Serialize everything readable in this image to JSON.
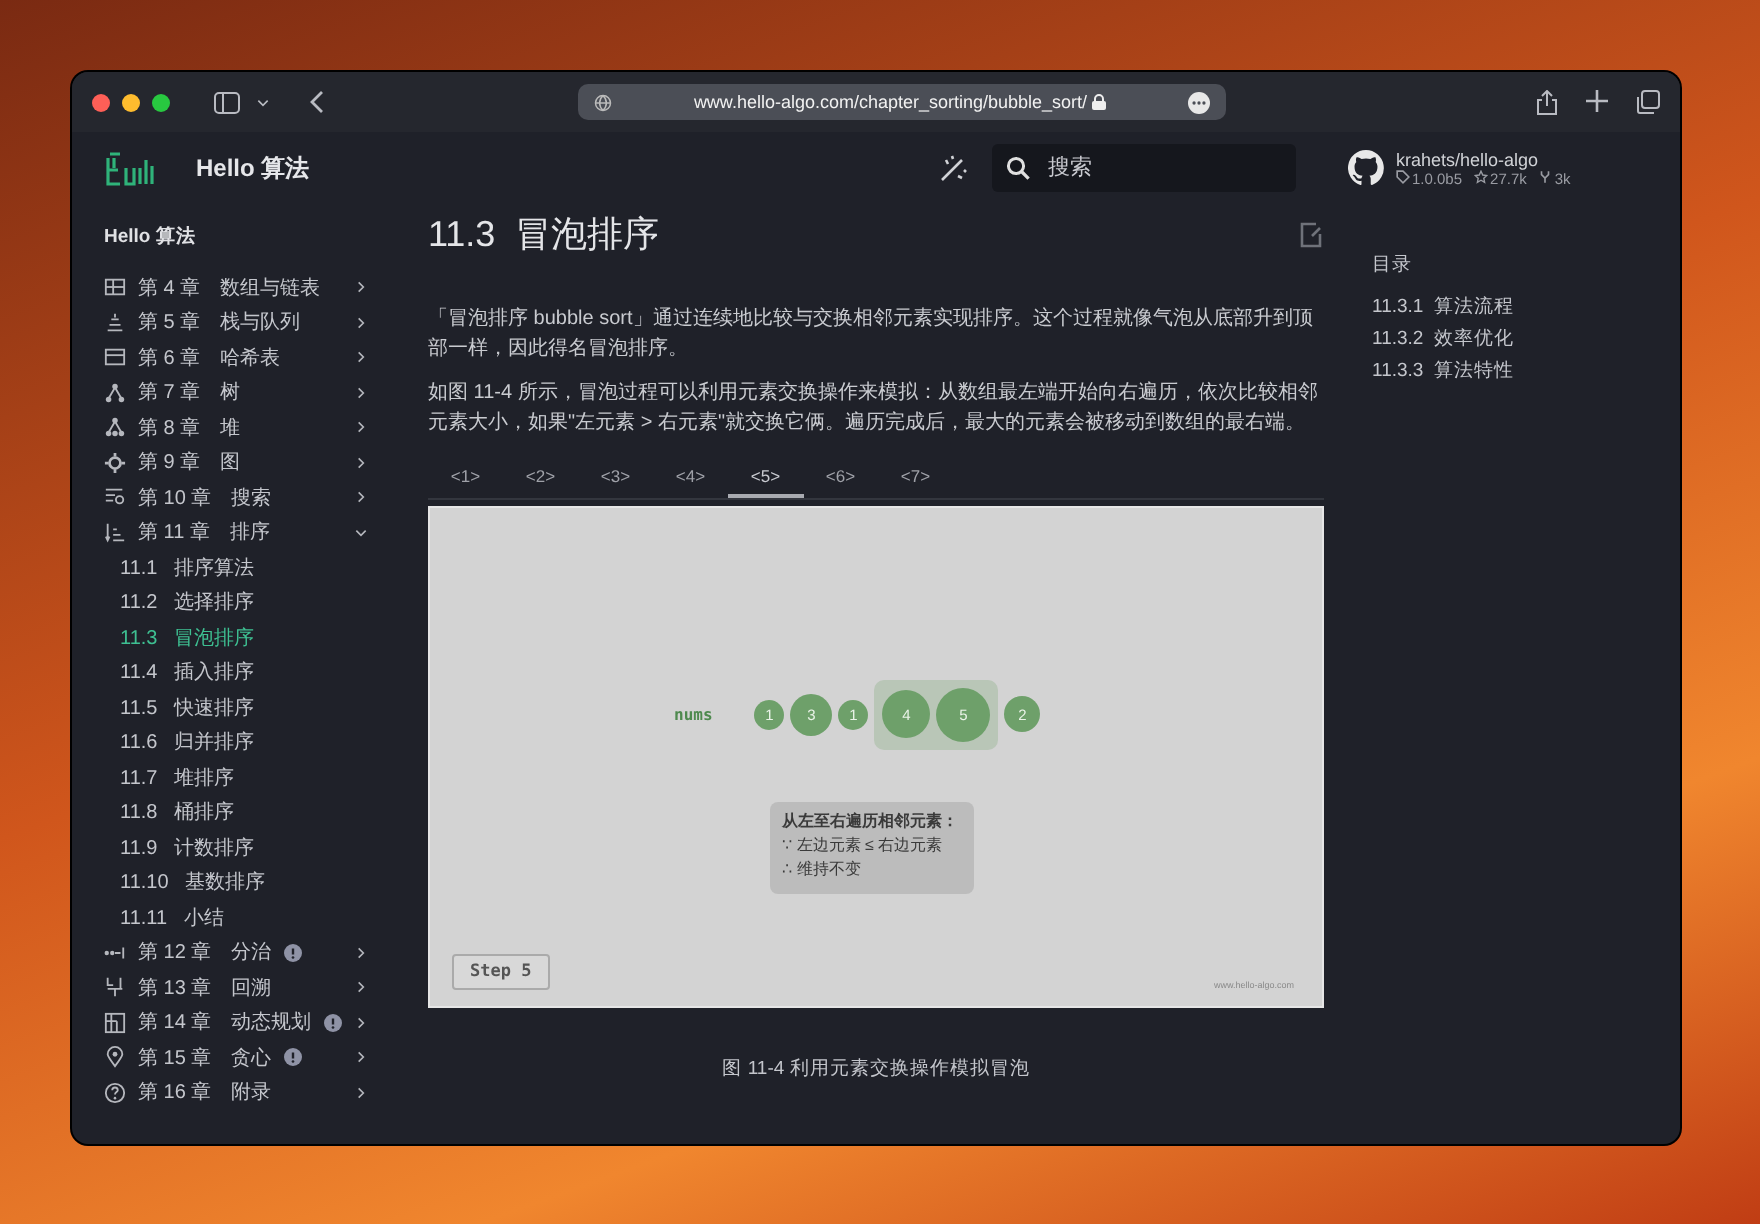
{
  "browser": {
    "url": "www.hello-algo.com/chapter_sorting/bubble_sort/"
  },
  "header": {
    "title": "Hello 算法",
    "search_placeholder": "搜索",
    "repo": {
      "name": "krahets/hello-algo",
      "version": "1.0.0b5",
      "stars": "27.7k",
      "forks": "3k"
    }
  },
  "sidebar": {
    "title": "Hello 算法",
    "items": [
      {
        "number": "第 4 章",
        "title": "数组与链表",
        "expanded": false,
        "badge": false
      },
      {
        "number": "第 5 章",
        "title": "栈与队列",
        "expanded": false,
        "badge": false
      },
      {
        "number": "第 6 章",
        "title": "哈希表",
        "expanded": false,
        "badge": false
      },
      {
        "number": "第 7 章",
        "title": "树",
        "expanded": false,
        "badge": false
      },
      {
        "number": "第 8 章",
        "title": "堆",
        "expanded": false,
        "badge": false
      },
      {
        "number": "第 9 章",
        "title": "图",
        "expanded": false,
        "badge": false
      },
      {
        "number": "第 10 章",
        "title": "搜索",
        "expanded": false,
        "badge": false
      },
      {
        "number": "第 11 章",
        "title": "排序",
        "expanded": true,
        "badge": false,
        "children": [
          {
            "number": "11.1",
            "title": "排序算法",
            "selected": false
          },
          {
            "number": "11.2",
            "title": "选择排序",
            "selected": false
          },
          {
            "number": "11.3",
            "title": "冒泡排序",
            "selected": true
          },
          {
            "number": "11.4",
            "title": "插入排序",
            "selected": false
          },
          {
            "number": "11.5",
            "title": "快速排序",
            "selected": false
          },
          {
            "number": "11.6",
            "title": "归并排序",
            "selected": false
          },
          {
            "number": "11.7",
            "title": "堆排序",
            "selected": false
          },
          {
            "number": "11.8",
            "title": "桶排序",
            "selected": false
          },
          {
            "number": "11.9",
            "title": "计数排序",
            "selected": false
          },
          {
            "number": "11.10",
            "title": "基数排序",
            "selected": false
          },
          {
            "number": "11.11",
            "title": "小结",
            "selected": false
          }
        ]
      },
      {
        "number": "第 12 章",
        "title": "分治",
        "expanded": false,
        "badge": true
      },
      {
        "number": "第 13 章",
        "title": "回溯",
        "expanded": false,
        "badge": false
      },
      {
        "number": "第 14 章",
        "title": "动态规划",
        "expanded": false,
        "badge": true
      },
      {
        "number": "第 15 章",
        "title": "贪心",
        "expanded": false,
        "badge": true
      },
      {
        "number": "第 16 章",
        "title": "附录",
        "expanded": false,
        "badge": false
      }
    ]
  },
  "content": {
    "heading_number": "11.3",
    "heading_title": "冒泡排序",
    "paragraphs": [
      "「冒泡排序 bubble sort」通过连续地比较与交换相邻元素实现排序。这个过程就像气泡从底部升到顶部一样，因此得名冒泡排序。",
      "如图 11-4 所示，冒泡过程可以利用元素交换操作来模拟：从数组最左端开始向右遍历，依次比较相邻元素大小，如果\"左元素 > 右元素\"就交换它俩。遍历完成后，最大的元素会被移动到数组的最右端。"
    ],
    "tabs": [
      {
        "label": "<1>",
        "selected": false
      },
      {
        "label": "<2>",
        "selected": false
      },
      {
        "label": "<3>",
        "selected": false
      },
      {
        "label": "<4>",
        "selected": false
      },
      {
        "label": "<5>",
        "selected": true
      },
      {
        "label": "<6>",
        "selected": false
      },
      {
        "label": "<7>",
        "selected": false
      }
    ],
    "figure": {
      "array_label": "nums",
      "elements": [
        {
          "value": "1",
          "highlighted": false
        },
        {
          "value": "3",
          "highlighted": false
        },
        {
          "value": "1",
          "highlighted": false
        },
        {
          "value": "4",
          "highlighted": true
        },
        {
          "value": "5",
          "highlighted": true
        },
        {
          "value": "2",
          "highlighted": false
        }
      ],
      "legend": {
        "title": "从左至右遍历相邻元素：",
        "lines": [
          "∵ 左边元素 ≤ 右边元素",
          "∴ 维持不变"
        ]
      },
      "step": "Step 5",
      "site": "www.hello-algo.com"
    },
    "caption": "图 11-4   利用元素交换操作模拟冒泡"
  },
  "toc": {
    "title": "目录",
    "items": [
      {
        "number": "11.3.1",
        "title": "算法流程"
      },
      {
        "number": "11.3.2",
        "title": "效率优化"
      },
      {
        "number": "11.3.3",
        "title": "算法特性"
      }
    ]
  }
}
